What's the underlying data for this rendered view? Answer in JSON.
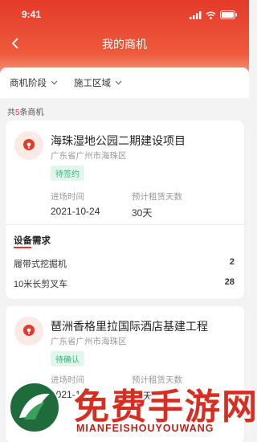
{
  "status_bar": {
    "time": "9:41"
  },
  "nav": {
    "title": "我的商机"
  },
  "filters": [
    {
      "label": "商机阶段"
    },
    {
      "label": "施工区域"
    }
  ],
  "summary": {
    "prefix": "共",
    "count": "5",
    "suffix": "条商机"
  },
  "cards": [
    {
      "title": "海珠湿地公园二期建设项目",
      "location": "广东省广州市海珠区",
      "status": "待签约",
      "entry_label": "进场时间",
      "entry_value": "2021-10-24",
      "days_label": "预计租赁天数",
      "days_value": "30天",
      "section_title": "设备需求",
      "equipment": [
        {
          "name": "履带式挖掘机",
          "qty": "2"
        },
        {
          "name": "10米长剪叉车",
          "qty": "28"
        }
      ]
    },
    {
      "title": "琶洲香格里拉国际酒店基建工程",
      "location": "广东省广州市海珠区",
      "status": "待确认",
      "entry_label": "进场时间",
      "entry_value": "2021-10-24",
      "days_label": "预计租赁天数",
      "days_value": "30天"
    }
  ],
  "watermark": {
    "title": "免费手游网",
    "subtitle": "MIANFEISHOUYOUWANG"
  },
  "colors": {
    "brand": "#e4392b",
    "status_tag": "#34b67a"
  }
}
